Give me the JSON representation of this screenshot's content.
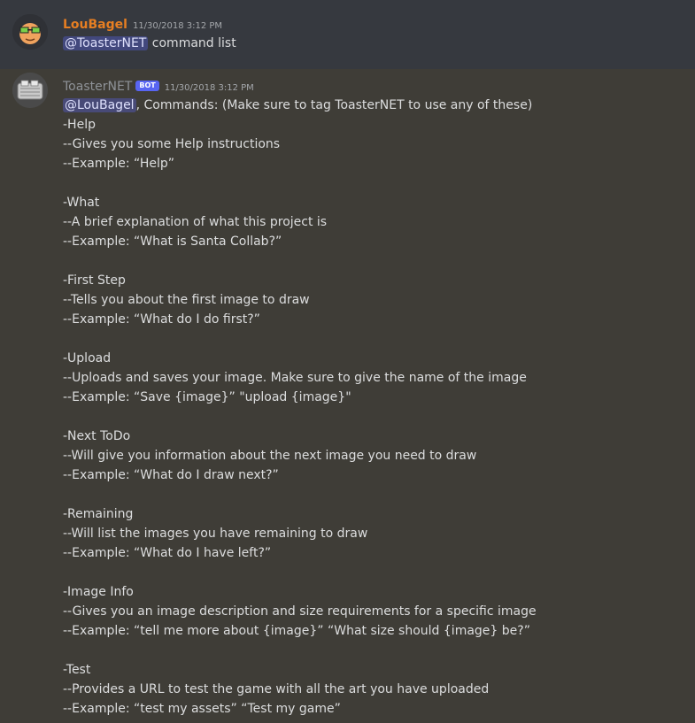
{
  "messages": [
    {
      "author": "LouBagel",
      "timestamp": "11/30/2018 3:12 PM",
      "mention": "@ToasterNET",
      "text": " command list"
    },
    {
      "author": "ToasterNET",
      "bot_tag": "BOT",
      "timestamp": "11/30/2018 3:12 PM",
      "mention": "@LouBagel",
      "first_line_text": ", Commands: (Make sure to tag ToasterNET to use any of these)",
      "lines": [
        "-Help",
        "--Gives you some Help instructions",
        "--Example: “Help”",
        "",
        "-What",
        "--A brief explanation of what this project is",
        "--Example: “What is Santa Collab?”",
        "",
        "-First Step",
        "--Tells you about the first image to draw",
        "--Example: “What do I do first?”",
        "",
        "-Upload",
        "--Uploads and saves your image.  Make sure to give the name of the image",
        "--Example: “Save {image}”  \"upload {image}\"",
        "",
        "-Next ToDo",
        "--Will give you information about the next image you need to draw",
        "--Example: “What do I draw next?”",
        "",
        "-Remaining",
        "--Will list the images you have remaining to draw",
        "--Example: “What do I have left?”",
        "",
        "-Image Info",
        "--Gives you an image description and size requirements for a specific image",
        "--Example: “tell me more about {image}” “What size should {image} be?”",
        "",
        "-Test",
        "--Provides a URL to test the game with all the art you have uploaded",
        "--Example: “test my assets” “Test my game”"
      ]
    }
  ]
}
